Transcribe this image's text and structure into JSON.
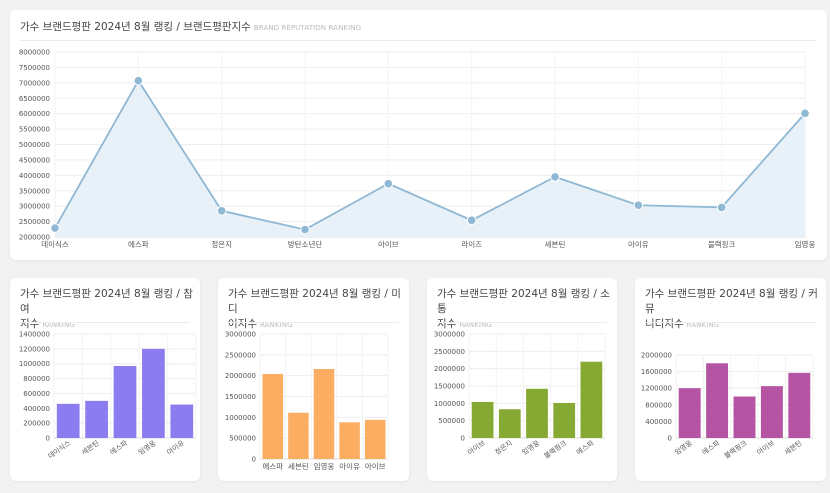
{
  "main": {
    "title": "가수 브랜드평판 2024년 8월 랭킹 / 브랜드평판지수",
    "subtitle": "BRAND REPUTATION RANKING"
  },
  "small_cards": [
    {
      "title_line1": "가수 브랜드평판 2024년 8월 랭킹 / 참여",
      "title_line2": "지수",
      "subtitle": "RANKING"
    },
    {
      "title_line1": "가수 브랜드평판 2024년 8월 랭킹 / 미디",
      "title_line2": "어지수",
      "subtitle": "RANKING"
    },
    {
      "title_line1": "가수 브랜드평판 2024년 8월 랭킹 / 소통",
      "title_line2": "지수",
      "subtitle": "RANKING"
    },
    {
      "title_line1": "가수 브랜드평판 2024년 8월 랭킹 / 커뮤",
      "title_line2": "니티지수",
      "subtitle": "RANKING"
    }
  ],
  "colors": {
    "line": "#8fb8d4",
    "area": "#e8f1f7",
    "bar1": "#8b7cf0",
    "bar2": "#fbae62",
    "bar3": "#86a934",
    "bar4": "#b454a3"
  },
  "chart_data": [
    {
      "type": "area",
      "categories": [
        "데이식스",
        "에스파",
        "정은지",
        "방탄소년단",
        "아이브",
        "라이즈",
        "세븐틴",
        "아이유",
        "블랙핑크",
        "임영웅"
      ],
      "values": [
        2290000,
        7070000,
        2850000,
        2240000,
        3730000,
        2540000,
        3950000,
        3030000,
        2960000,
        6010000
      ],
      "yticks": [
        "8000000",
        "7500000",
        "7000000",
        "6500000",
        "6000000",
        "5500000",
        "5000000",
        "4500000",
        "4000000",
        "3500000",
        "3000000",
        "2500000",
        "2000000"
      ],
      "ylim": [
        2000000,
        8000000
      ],
      "grid": true
    },
    {
      "type": "bar",
      "categories": [
        "데이식스",
        "세븐틴",
        "에스파",
        "임영웅",
        "아이유"
      ],
      "values": [
        460000,
        500000,
        970000,
        1200000,
        450000
      ],
      "yticks": [
        "1400000",
        "1200000",
        "1000000",
        "800000",
        "600000",
        "400000",
        "200000",
        "0"
      ],
      "ylim": [
        0,
        1400000
      ],
      "grid": true
    },
    {
      "type": "bar",
      "categories": [
        "에스파",
        "세븐틴",
        "임영웅",
        "아이유",
        "아이브"
      ],
      "values": [
        2040000,
        1110000,
        2160000,
        880000,
        940000
      ],
      "yticks": [
        "3000000",
        "2500000",
        "2000000",
        "1500000",
        "1000000",
        "500000",
        "0"
      ],
      "ylim": [
        0,
        3000000
      ],
      "grid": true
    },
    {
      "type": "bar",
      "categories": [
        "아이브",
        "정은지",
        "임영웅",
        "블랙핑크",
        "에스파"
      ],
      "values": [
        1040000,
        830000,
        1420000,
        1010000,
        2200000
      ],
      "yticks": [
        "3000000",
        "2500000",
        "2000000",
        "1500000",
        "1000000",
        "500000",
        "0"
      ],
      "ylim": [
        0,
        3000000
      ],
      "grid": true
    },
    {
      "type": "bar",
      "categories": [
        "임영웅",
        "에스파",
        "블랙핑크",
        "아이브",
        "세븐틴"
      ],
      "values": [
        1200000,
        1800000,
        1000000,
        1250000,
        1570000
      ],
      "yticks": [
        "2000000",
        "1600000",
        "1200000",
        "800000",
        "400000",
        "0"
      ],
      "ylim": [
        0,
        2000000
      ],
      "grid": true
    }
  ]
}
